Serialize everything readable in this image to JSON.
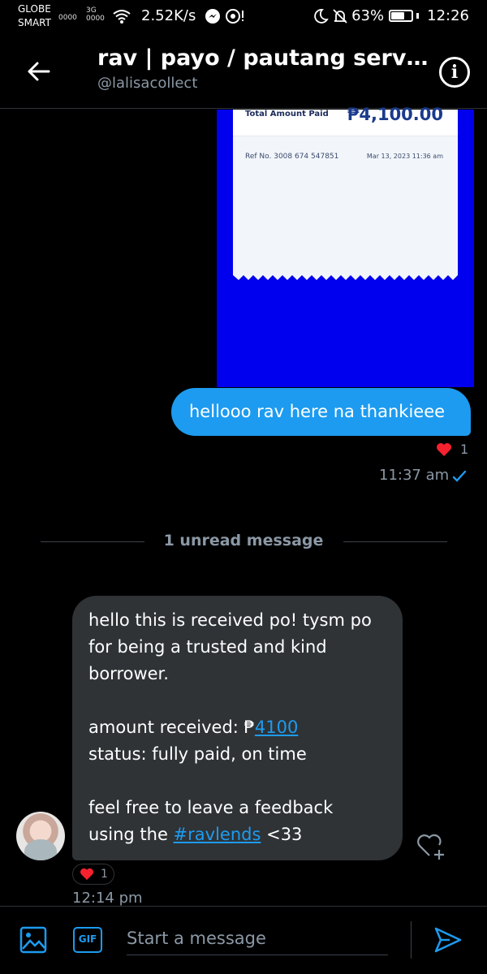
{
  "status_bar": {
    "carrier1": "GLOBE",
    "carrier2": "SMART",
    "signal1": "0000",
    "network": "3G",
    "signal2": "0000",
    "speed": "2.52K/s",
    "battery": "63%",
    "time": "12:26"
  },
  "header": {
    "title": "rav | payo / pautang servic...",
    "handle": "@lalisacollect",
    "info_icon": "i"
  },
  "receipt": {
    "label": "Total Amount Paid",
    "amount": "₱4,100.00",
    "ref": "Ref No. 3008 674 547851",
    "date": "Mar 13, 2023 11:36 am"
  },
  "outgoing": {
    "text": "hellooo rav here na thankieee",
    "reaction_count": "1",
    "time": "11:37 am"
  },
  "divider": {
    "label": "1 unread message"
  },
  "incoming": {
    "line1": "hello this is received po! tysm po for being a trusted and kind borrower.",
    "amount_prefix": "amount received: ₱",
    "amount_link": "4100",
    "status": "status: fully paid, on time",
    "feedback1": "feel free to leave a feedback",
    "feedback_prefix": "using the ",
    "hashtag": "#ravlends",
    "feedback_suffix": " <33",
    "reaction_count": "1",
    "time": "12:14 pm"
  },
  "composer": {
    "gif_label": "GIF",
    "placeholder": "Start a message"
  },
  "colors": {
    "accent": "#1d9bf0",
    "bubble_in": "#2f3336",
    "receipt_bg": "#0000ee",
    "heart": "#f91880"
  }
}
